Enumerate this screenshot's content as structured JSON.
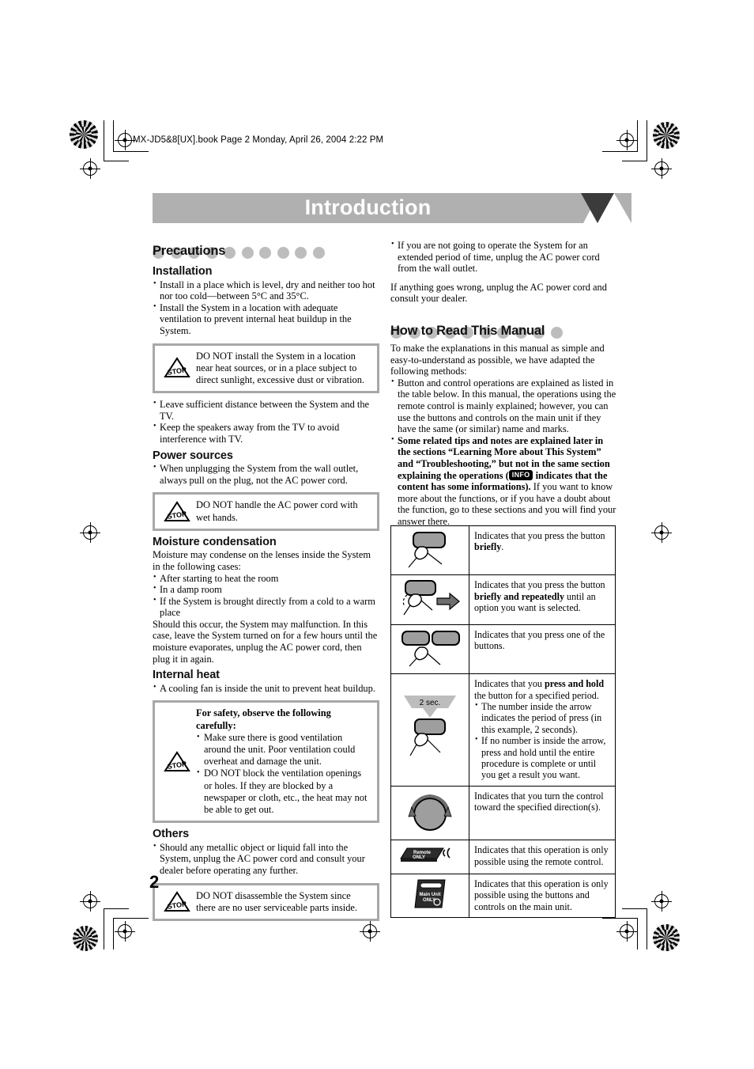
{
  "header": {
    "file_line": "MX-JD5&8[UX].book  Page 2  Monday, April 26, 2004  2:22 PM"
  },
  "banner": {
    "title": "Introduction"
  },
  "page_number": "2",
  "colors": {
    "banner_bg": "#b0b0b0",
    "banner_arrow": "#3b3b3b",
    "dot": "#bdbdbd",
    "caution_border": "#a8a8a8"
  },
  "left_column": {
    "section_title": "Precautions",
    "installation": {
      "heading": "Installation",
      "bullets": [
        "Install in a place which is level, dry and neither too hot nor too cold—between 5°C and 35°C.",
        "Install the System in a location with adequate ventilation to prevent internal heat buildup in the System."
      ],
      "caution": "DO NOT install the System in a location near heat sources, or in a place subject to direct sunlight, excessive dust or vibration.",
      "bullets_after": [
        "Leave sufficient distance between the System and the TV.",
        "Keep the speakers away from the TV to avoid interference with TV."
      ]
    },
    "power_sources": {
      "heading": "Power sources",
      "bullets": [
        "When unplugging the System from the wall outlet, always pull on the plug, not the AC power cord."
      ],
      "caution": "DO NOT handle the AC power cord with wet hands."
    },
    "moisture": {
      "heading": "Moisture condensation",
      "intro": "Moisture may condense on the lenses inside the System in the following cases:",
      "bullets": [
        "After starting to heat the room",
        "In a damp room",
        "If the System is brought directly from a cold to a warm place"
      ],
      "outro": "Should this occur, the System may malfunction. In this case, leave the System turned on for a few hours until the moisture evaporates, unplug the AC power cord, then plug it in again."
    },
    "internal_heat": {
      "heading": "Internal heat",
      "bullets": [
        "A cooling fan is inside the unit to prevent heat buildup."
      ],
      "caution_title": "For safety, observe the following carefully:",
      "caution_bullets": [
        "Make sure there is good ventilation around the unit. Poor ventilation could overheat and damage the unit.",
        "DO NOT block the ventilation openings or holes. If they are blocked by a newspaper or cloth, etc., the heat may not be able to get out."
      ]
    },
    "others": {
      "heading": "Others",
      "bullets": [
        "Should any metallic object or liquid fall into the System, unplug the AC power cord and consult your dealer before operating any further."
      ],
      "caution": "DO NOT disassemble the System since there are no user serviceable parts inside."
    }
  },
  "right_column": {
    "top_bullets": [
      "If you are not going to operate the System for an extended period of time, unplug the AC power cord from the wall outlet."
    ],
    "top_paragraph": "If anything goes wrong, unplug the AC power cord and consult your dealer.",
    "section_title": "How to Read This Manual",
    "intro": "To make the explanations in this manual as simple and easy-to-understand as possible, we have adapted the following methods:",
    "bullet1": "Button and control operations are explained as listed in the table below. In this manual, the operations using the remote control is mainly explained; however, you can use the buttons and controls on the main unit if they have the same (or similar) name and marks.",
    "bullet2_bold_a": "Some related tips and notes are explained later in the sections “Learning More about This System” and “Troubleshooting,” but not in the same section explaining the operations (",
    "bullet2_badge": "INFO",
    "bullet2_bold_b": " indicates that the content has some informations).",
    "bullet2_rest": " If you want to know more about the functions, or if you have a doubt about the function, go to these sections and you will find your answer there."
  },
  "manual_table": {
    "rows": [
      {
        "figure": "press-button-briefly-figure",
        "text_pre": "Indicates that you press the button ",
        "text_bold": "briefly",
        "text_post": "."
      },
      {
        "figure": "press-button-repeatedly-figure",
        "text_pre": "Indicates that you press the button ",
        "text_bold": "briefly and repeatedly",
        "text_post": " until an option you want is selected."
      },
      {
        "figure": "press-one-of-buttons-figure",
        "text_pre": "Indicates that you press one of the buttons.",
        "text_bold": "",
        "text_post": ""
      },
      {
        "figure": "press-and-hold-figure",
        "figure_label": "2 sec.",
        "text_pre": "Indicates that you ",
        "text_bold": "press and hold",
        "text_post": " the button for a specified period.",
        "bullets": [
          "The number inside the arrow indicates the period of press (in this example, 2 seconds).",
          "If no number is inside the arrow, press and hold until the entire procedure is complete or until you get a result you want."
        ]
      },
      {
        "figure": "turn-control-knob-figure",
        "text_pre": "Indicates that you turn the control toward the specified direction(s).",
        "text_bold": "",
        "text_post": ""
      },
      {
        "figure": "remote-only-badge",
        "badge_line1": "Remote",
        "badge_line2": "ONLY",
        "text_pre": "Indicates that this operation is only possible using the remote control.",
        "text_bold": "",
        "text_post": ""
      },
      {
        "figure": "main-unit-only-badge",
        "badge_line1": "Main Unit",
        "badge_line2": "ONLY",
        "text_pre": "Indicates that this operation is only possible using the buttons and controls on the main unit.",
        "text_bold": "",
        "text_post": ""
      }
    ]
  }
}
